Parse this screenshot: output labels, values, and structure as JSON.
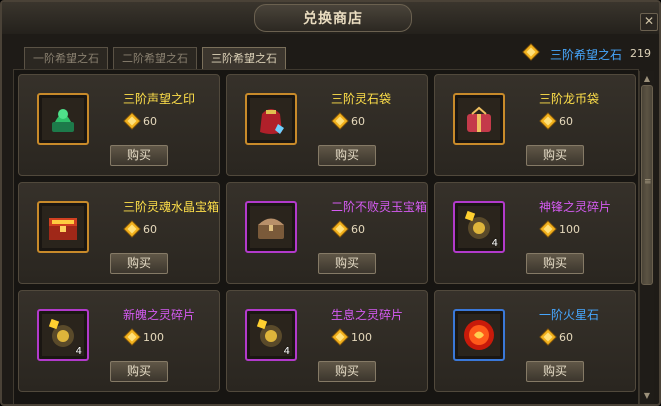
{
  "window": {
    "title": "兑换商店",
    "close_icon": "close-icon"
  },
  "tabs": [
    {
      "label": "一阶希望之石",
      "active": false
    },
    {
      "label": "二阶希望之石",
      "active": false
    },
    {
      "label": "三阶希望之石",
      "active": true
    }
  ],
  "currency": {
    "name": "三阶希望之石",
    "amount": "219",
    "icon": "gem-icon"
  },
  "items": [
    {
      "name": "三阶声望之印",
      "price": "60",
      "qty": "",
      "rarity": "gold",
      "icon": "jade-seal-icon"
    },
    {
      "name": "三阶灵石袋",
      "price": "60",
      "qty": "",
      "rarity": "gold",
      "icon": "stone-bag-icon"
    },
    {
      "name": "三阶龙币袋",
      "price": "60",
      "qty": "",
      "rarity": "gold",
      "icon": "coin-bag-icon"
    },
    {
      "name": "三阶灵魂水晶宝箱",
      "price": "60",
      "qty": "",
      "rarity": "gold",
      "icon": "treasure-chest-icon"
    },
    {
      "name": "二阶不败灵玉宝箱",
      "price": "60",
      "qty": "",
      "rarity": "purple",
      "icon": "jade-chest-icon"
    },
    {
      "name": "神锋之灵碎片",
      "price": "100",
      "qty": "4",
      "rarity": "purple",
      "icon": "spirit-shard-icon"
    },
    {
      "name": "新魄之灵碎片",
      "price": "100",
      "qty": "4",
      "rarity": "purple",
      "icon": "spirit-shard-icon"
    },
    {
      "name": "生息之灵碎片",
      "price": "100",
      "qty": "4",
      "rarity": "purple",
      "icon": "spirit-shard-icon"
    },
    {
      "name": "一阶火星石",
      "price": "60",
      "qty": "",
      "rarity": "blue",
      "icon": "fire-stone-icon"
    }
  ],
  "buy_label": "购买",
  "colors": {
    "gold": "#ffe04a",
    "purple": "#d55bf2",
    "blue": "#47a8ff"
  }
}
